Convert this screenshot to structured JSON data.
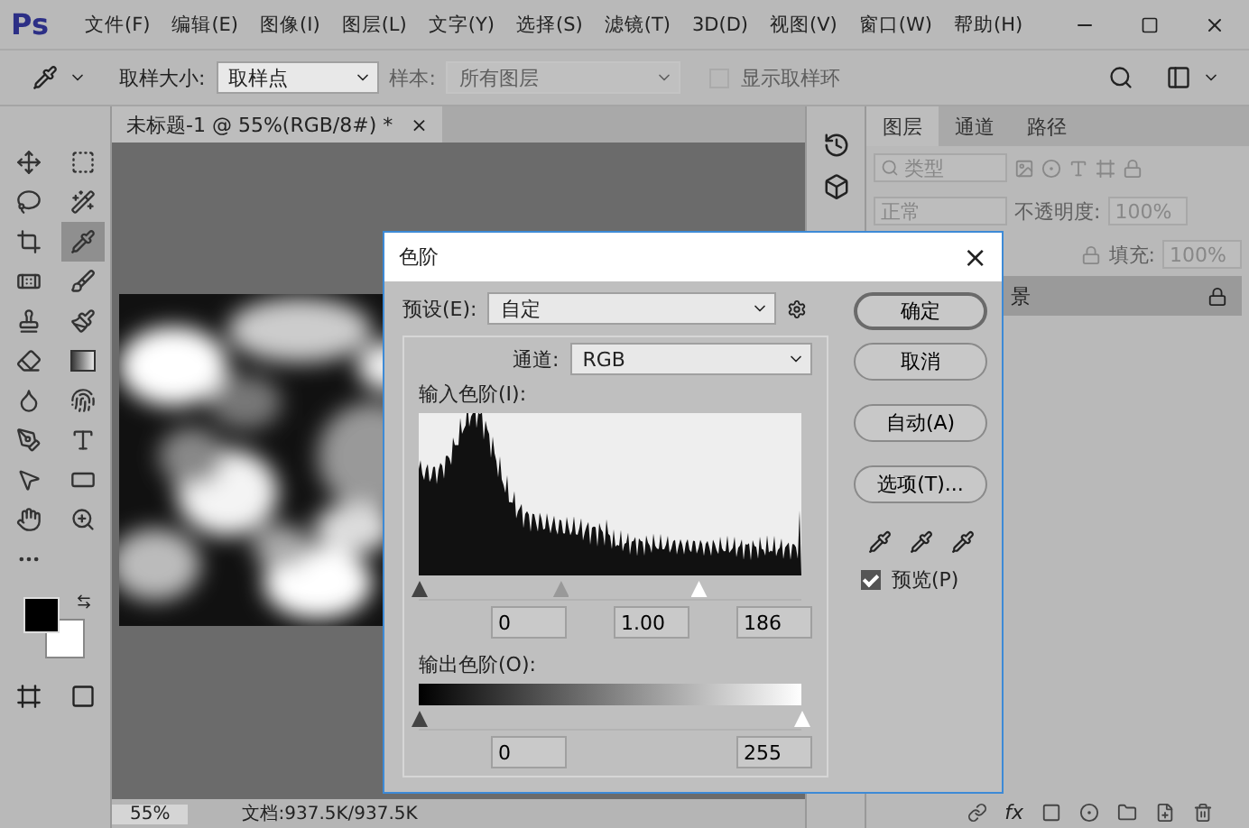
{
  "app": {
    "logo": "Ps",
    "menu": [
      "文件(F)",
      "编辑(E)",
      "图像(I)",
      "图层(L)",
      "文字(Y)",
      "选择(S)",
      "滤镜(T)",
      "3D(D)",
      "视图(V)",
      "窗口(W)",
      "帮助(H)"
    ]
  },
  "options_bar": {
    "sample_size_label": "取样大小:",
    "sample_size": "取样点",
    "sample_label": "样本:",
    "sample": "所有图层",
    "sample_disabled": true,
    "show_ring": {
      "label": "显示取样环",
      "checked": false,
      "disabled": true
    }
  },
  "tools": [
    {
      "selected": false
    },
    {
      "selected": false
    },
    {
      "selected": false
    },
    {
      "selected": false
    },
    {
      "selected": false
    },
    {
      "selected": true
    },
    {
      "selected": false
    },
    {
      "selected": false
    },
    {
      "selected": false
    },
    {
      "selected": false
    },
    {
      "selected": false
    },
    {
      "selected": false
    },
    {
      "selected": false
    },
    {
      "selected": false
    },
    {
      "selected": false
    },
    {
      "selected": false
    },
    {
      "selected": false
    },
    {
      "selected": false
    },
    {
      "selected": false
    },
    {
      "selected": false
    },
    {
      "selected": false
    }
  ],
  "document": {
    "tab": "未标题-1 @ 55%(RGB/8#) *",
    "close": "×",
    "zoom": "55%",
    "doc_size": "文档:937.5K/937.5K"
  },
  "layers_panel": {
    "tabs": [
      {
        "label": "图层",
        "selected": true
      },
      {
        "label": "通道",
        "selected": false
      },
      {
        "label": "路径",
        "selected": false
      }
    ],
    "filter": "类型",
    "blend": "正常",
    "opacity_label": "不透明度:",
    "opacity": "100%",
    "fill_label": "填充:",
    "fill": "100%",
    "layer": "景",
    "fx": "fx"
  },
  "dialog": {
    "title": "色阶",
    "close": "×",
    "preset_label": "预设(E):",
    "preset": "自定",
    "channel_label": "通道:",
    "channel": "RGB",
    "input_label": "输入色阶(I):",
    "input_sliders": [
      {
        "level": 0
      },
      {
        "level": 0.37
      },
      {
        "level": 0.73
      }
    ],
    "input_values": [
      "0",
      "1.00",
      "186"
    ],
    "output_label": "输出色阶(O):",
    "output_sliders": [
      {
        "level": 0
      },
      {
        "level": 1
      }
    ],
    "output_values": [
      "0",
      "255"
    ],
    "buttons": [
      {
        "label": "确定",
        "default": true
      },
      {
        "label": "取消",
        "default": false
      },
      {
        "label": "自动(A)",
        "default": false
      },
      {
        "label": "选项(T)...",
        "default": false
      }
    ],
    "preview": {
      "label": "预览(P)",
      "checked": true
    }
  }
}
